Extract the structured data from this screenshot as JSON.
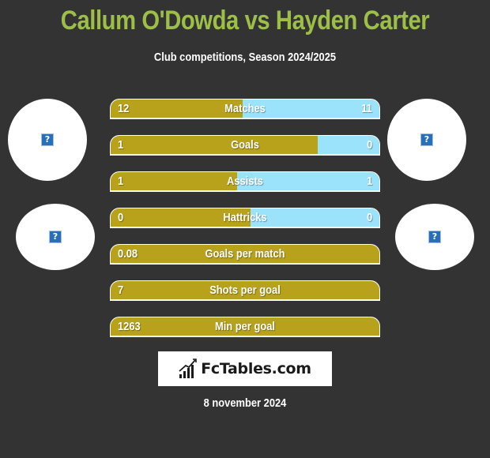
{
  "header": {
    "title": "Callum O'Dowda vs Hayden Carter",
    "subtitle": "Club competitions, Season 2024/2025"
  },
  "players": {
    "left": {
      "name": "Callum O'Dowda",
      "photo_icon": "broken-image-icon",
      "club_icon": "broken-image-icon"
    },
    "right": {
      "name": "Hayden Carter",
      "photo_icon": "broken-image-icon",
      "club_icon": "broken-image-icon"
    }
  },
  "colors": {
    "left_bar": "#b9a21b",
    "right_bar": "#9be3fb",
    "title": "#9dbf47",
    "background": "#333333"
  },
  "stats": [
    {
      "label": "Matches",
      "left": "12",
      "right": "11",
      "left_fill": 0.49
    },
    {
      "label": "Goals",
      "left": "1",
      "right": "0",
      "left_fill": 0.77
    },
    {
      "label": "Assists",
      "left": "1",
      "right": "1",
      "left_fill": 0.47
    },
    {
      "label": "Hattricks",
      "left": "0",
      "right": "0",
      "left_fill": 0.52
    },
    {
      "label": "Goals per match",
      "left": "0.08",
      "right": "",
      "left_fill": 1.0
    },
    {
      "label": "Shots per goal",
      "left": "7",
      "right": "",
      "left_fill": 1.0
    },
    {
      "label": "Min per goal",
      "left": "1263",
      "right": "",
      "left_fill": 1.0
    }
  ],
  "footer": {
    "logo_text": "FcTables.com",
    "date": "8 november 2024"
  }
}
